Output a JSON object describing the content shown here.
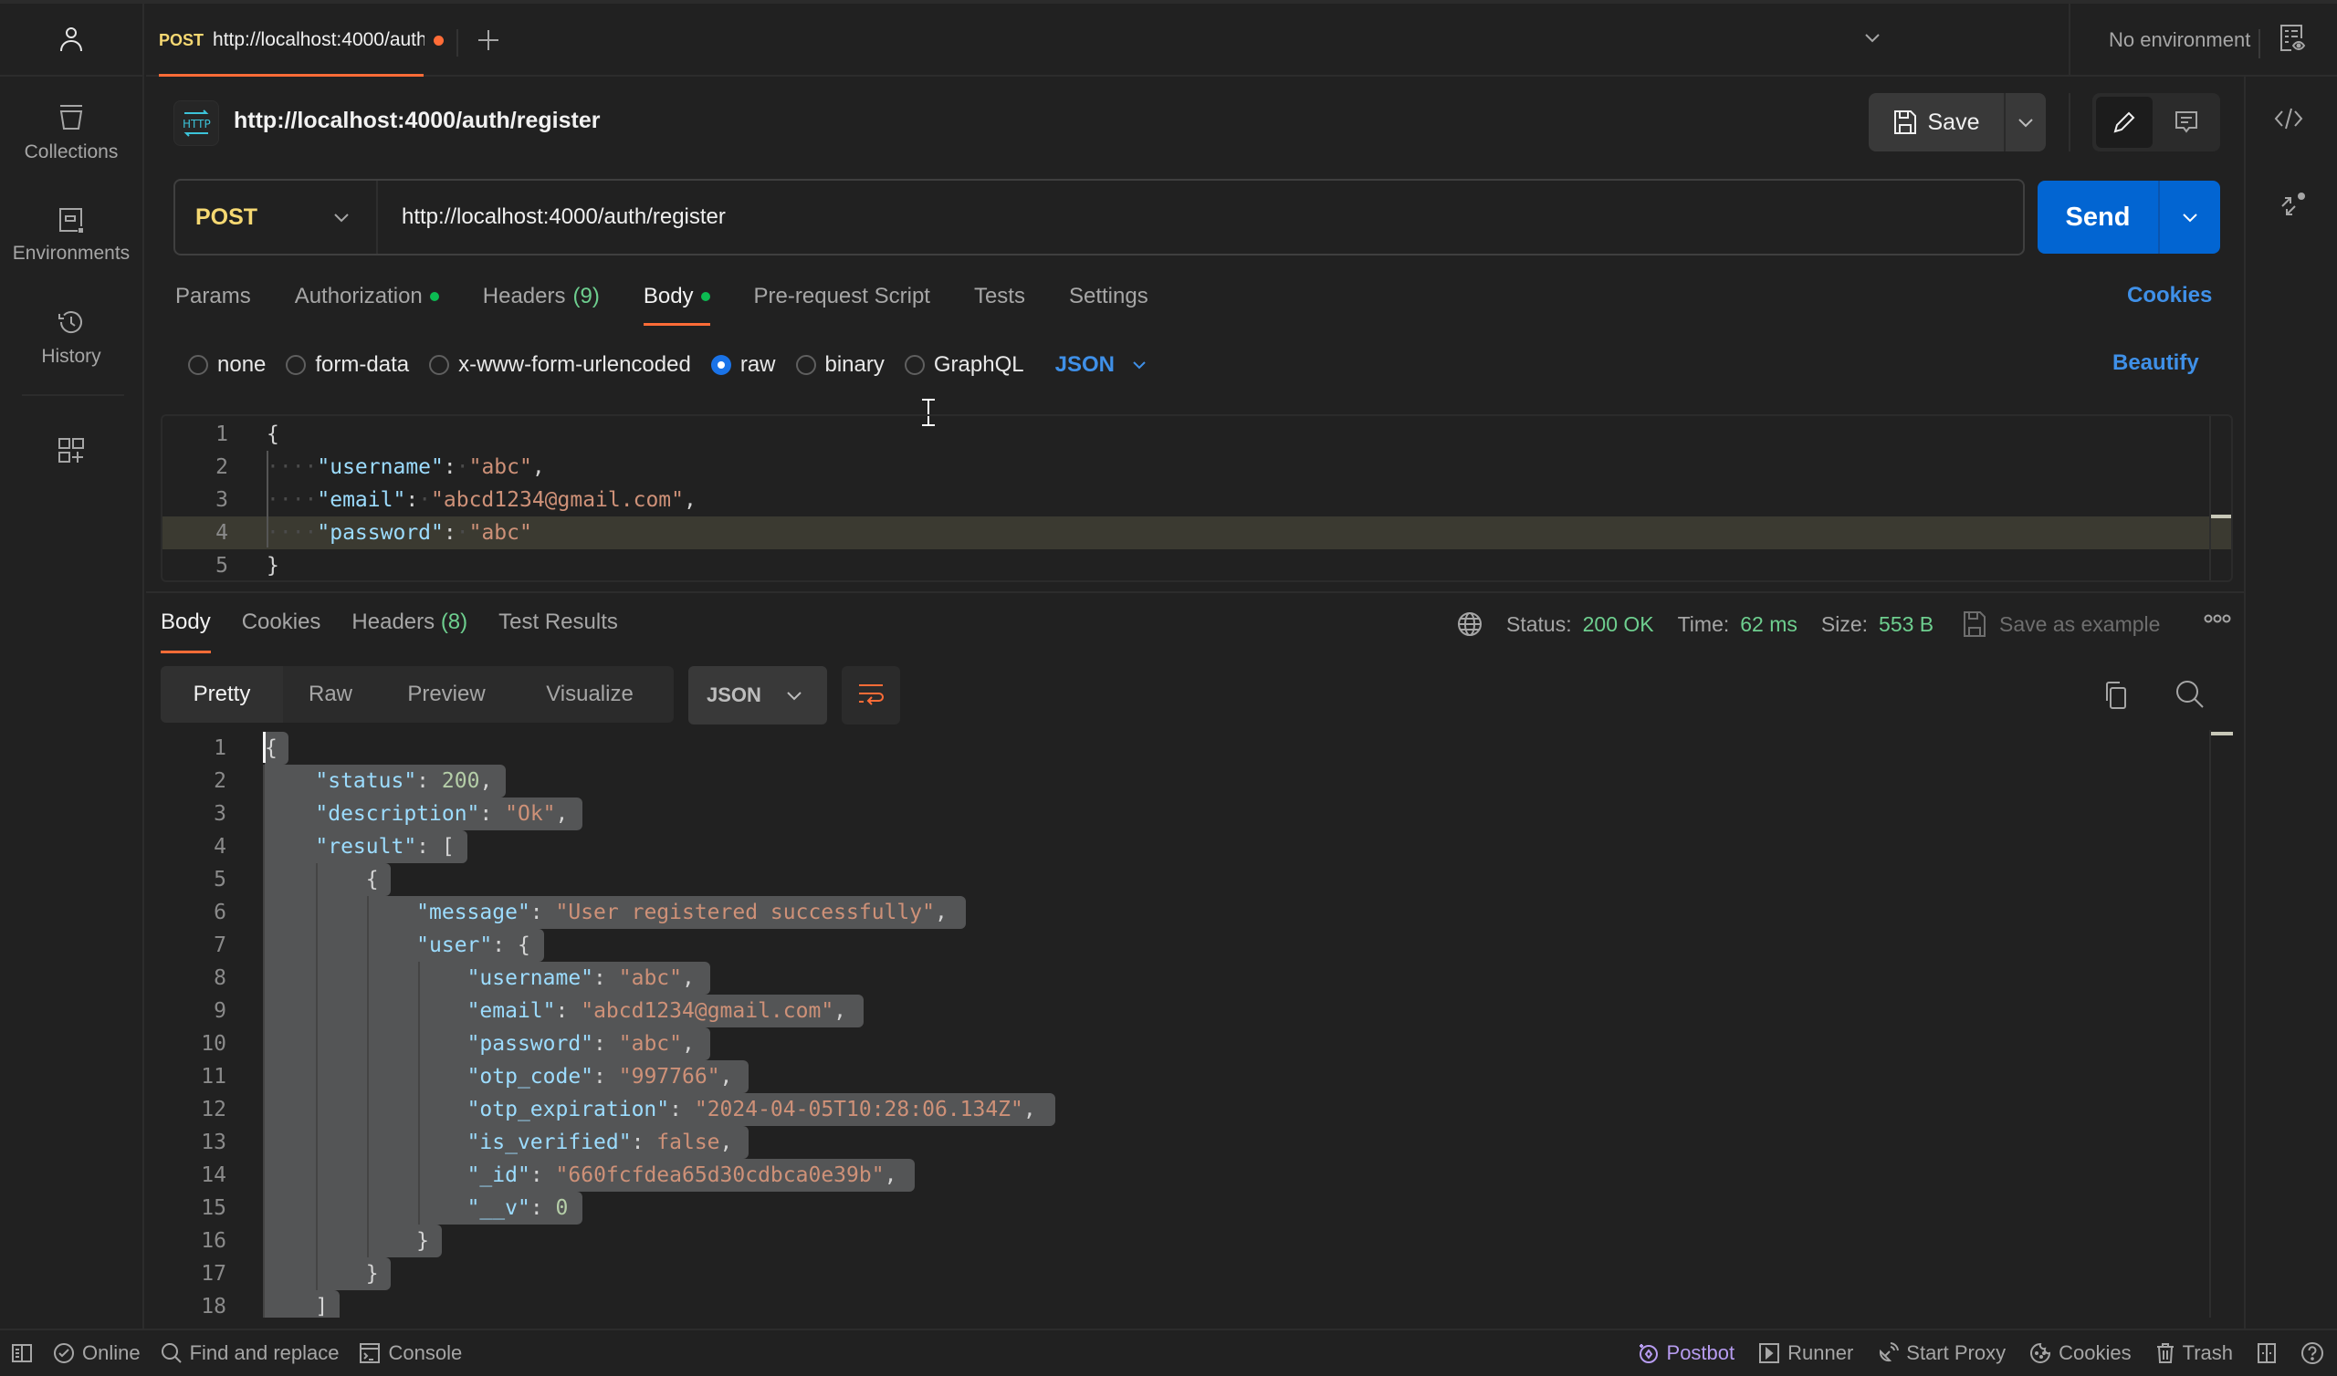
{
  "sidebar": {
    "items": [
      {
        "label": "Collections",
        "icon": "collections-icon"
      },
      {
        "label": "Environments",
        "icon": "environments-icon"
      },
      {
        "label": "History",
        "icon": "history-icon"
      }
    ],
    "configure_icon": "add-workspace-sidebar-icon"
  },
  "tabbar": {
    "active_tab": {
      "method": "POST",
      "url": "http://localhost:4000/auth/register",
      "unsaved": true
    },
    "environment": "No environment"
  },
  "request": {
    "title": "http://localhost:4000/auth/register",
    "save_label": "Save",
    "method": "POST",
    "url": "http://localhost:4000/auth/register",
    "send_label": "Send",
    "tabs": [
      {
        "label": "Params"
      },
      {
        "label": "Authorization",
        "dot": true
      },
      {
        "label": "Headers",
        "count": "(9)"
      },
      {
        "label": "Body",
        "dot": true,
        "active": true
      },
      {
        "label": "Pre-request Script"
      },
      {
        "label": "Tests"
      },
      {
        "label": "Settings"
      }
    ],
    "cookies_label": "Cookies",
    "body_types": [
      "none",
      "form-data",
      "x-www-form-urlencoded",
      "raw",
      "binary",
      "GraphQL"
    ],
    "selected_body_type": "raw",
    "body_format": "JSON",
    "beautify_label": "Beautify",
    "body_lines": [
      "{",
      "    \"username\": \"abc\",",
      "    \"email\": \"abcd1234@gmail.com\",",
      "    \"password\": \"abc\"",
      "}"
    ],
    "highlighted_line": 4
  },
  "response": {
    "tabs": [
      {
        "label": "Body",
        "active": true
      },
      {
        "label": "Cookies"
      },
      {
        "label": "Headers",
        "count": "(8)"
      },
      {
        "label": "Test Results"
      }
    ],
    "status_label": "Status:",
    "status": "200 OK",
    "time_label": "Time:",
    "time": "62 ms",
    "size_label": "Size:",
    "size": "553 B",
    "save_example_label": "Save as example",
    "views": [
      "Pretty",
      "Raw",
      "Preview",
      "Visualize"
    ],
    "active_view": "Pretty",
    "format": "JSON",
    "body_lines": [
      "{",
      "    \"status\": 200,",
      "    \"description\": \"Ok\",",
      "    \"result\": [",
      "        {",
      "            \"message\": \"User registered successfully\",",
      "            \"user\": {",
      "                \"username\": \"abc\",",
      "                \"email\": \"abcd1234@gmail.com\",",
      "                \"password\": \"abc\",",
      "                \"otp_code\": \"997766\",",
      "                \"otp_expiration\": \"2024-04-05T10:28:06.134Z\",",
      "                \"is_verified\": false,",
      "                \"_id\": \"660fcfdea65d30cdbca0e39b\",",
      "                \"__v\": 0",
      "            }",
      "        }",
      "    ]"
    ]
  },
  "footer": {
    "left": [
      "Online",
      "Find and replace",
      "Console"
    ],
    "right": [
      "Postbot",
      "Runner",
      "Start Proxy",
      "Cookies",
      "Trash"
    ]
  },
  "colors": {
    "accent": "#ff6c37",
    "send": "#0265d2",
    "link": "#3f90e8",
    "method_post": "#f5d872",
    "success": "#6ecf8f",
    "json_key": "#9cdcfe",
    "json_string": "#ce9178",
    "json_number": "#b5cea8",
    "postbot": "#b79cf0"
  }
}
